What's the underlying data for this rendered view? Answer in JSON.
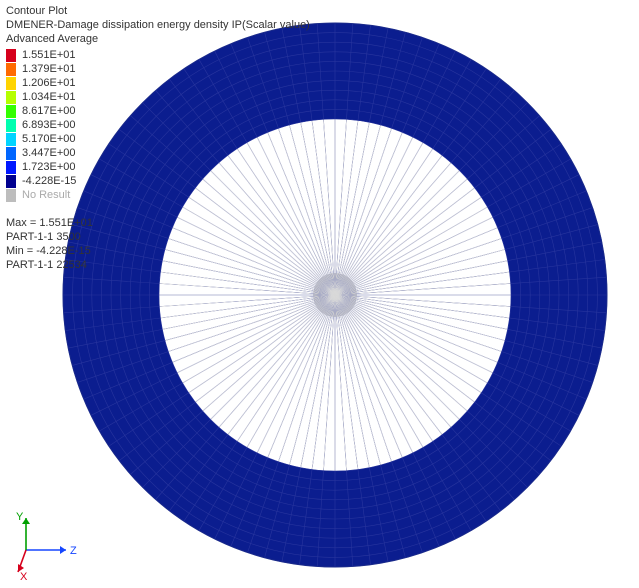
{
  "header": {
    "title": "Contour Plot",
    "subtitle": "DMENER-Damage dissipation energy density IP(Scalar value)",
    "avg": "Advanced Average"
  },
  "legend": {
    "entries": [
      {
        "color": "#d6001c",
        "label": "1.551E+01"
      },
      {
        "color": "#ff6a00",
        "label": "1.379E+01"
      },
      {
        "color": "#ffd400",
        "label": "1.206E+01"
      },
      {
        "color": "#b5ff00",
        "label": "1.034E+01"
      },
      {
        "color": "#33ff00",
        "label": "8.617E+00"
      },
      {
        "color": "#00ffb0",
        "label": "6.893E+00"
      },
      {
        "color": "#00d4ff",
        "label": "5.170E+00"
      },
      {
        "color": "#0066ff",
        "label": "3.447E+00"
      },
      {
        "color": "#0018ff",
        "label": "1.723E+00"
      },
      {
        "color": "#00008f",
        "label": "-4.228E-15"
      }
    ],
    "no_result_color": "#bdbdbd",
    "no_result_label": "No Result"
  },
  "stats": {
    "max_line": "Max = 1.551E+01",
    "max_loc": "PART-1-1 3500",
    "min_line": "Min = -4.228E-15",
    "min_loc": "PART-1-1 22534"
  },
  "axes": {
    "y": "Y",
    "z": "Z",
    "x": "X"
  },
  "chart_data": {
    "type": "heatmap",
    "title": "DMENER-Damage dissipation energy density IP (Scalar value) — Contour Plot, Advanced Average",
    "description": "Axisymmetric disc FE mesh viewed face-on. Outer annulus (roughly outer 35% of radius) shows damage dissipation energy density at the scale minimum (~ -4.228E-15, dark blue). Inner disc shows No Result (grey).",
    "geometry": {
      "shape": "disc",
      "outer_radius_px": 272,
      "inner_no_result_radius_px": 176,
      "hub_radius_px": 22,
      "radial_divisions": 24,
      "circumferential_divisions": 96
    },
    "field": {
      "name": "DMENER",
      "units": "energy density",
      "min": -4.228e-15,
      "max": 15.51,
      "outer_annulus_value": -4.228e-15,
      "inner_region": "No Result"
    },
    "colorscale": [
      {
        "value": 15.51,
        "color": "#d6001c"
      },
      {
        "value": 13.79,
        "color": "#ff6a00"
      },
      {
        "value": 12.06,
        "color": "#ffd400"
      },
      {
        "value": 10.34,
        "color": "#b5ff00"
      },
      {
        "value": 8.617,
        "color": "#33ff00"
      },
      {
        "value": 6.893,
        "color": "#00ffb0"
      },
      {
        "value": 5.17,
        "color": "#00d4ff"
      },
      {
        "value": 3.447,
        "color": "#0066ff"
      },
      {
        "value": 1.723,
        "color": "#0018ff"
      },
      {
        "value": -4.228e-15,
        "color": "#00008f"
      }
    ]
  }
}
